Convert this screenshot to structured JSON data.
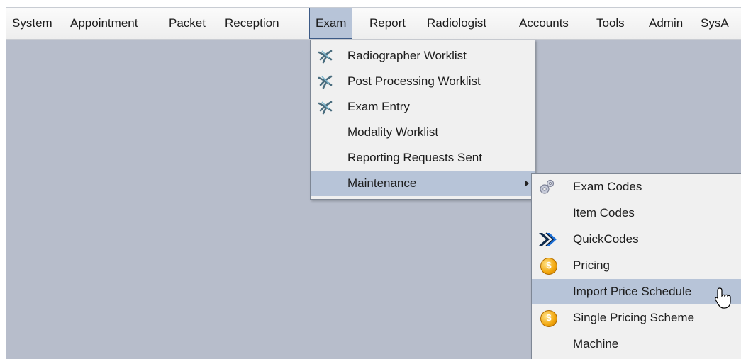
{
  "menubar": {
    "items": [
      {
        "label": "System",
        "underline": "y"
      },
      {
        "label": "Appointment"
      },
      {
        "label": "Packet"
      },
      {
        "label": "Reception"
      },
      {
        "label": "Exam",
        "active": true
      },
      {
        "label": "Report"
      },
      {
        "label": "Radiologist"
      },
      {
        "label": "Accounts"
      },
      {
        "label": "Tools"
      },
      {
        "label": "Admin"
      },
      {
        "label": "SysA"
      }
    ]
  },
  "exam_menu": {
    "items": [
      {
        "label": "Radiographer Worklist",
        "icon": "worklist-icon"
      },
      {
        "label": "Post Processing Worklist",
        "icon": "worklist-icon"
      },
      {
        "label": "Exam Entry",
        "icon": "worklist-icon"
      },
      {
        "label": "Modality Worklist"
      },
      {
        "label": "Reporting Requests Sent"
      },
      {
        "label": "Maintenance",
        "submenu": true,
        "selected": true
      }
    ]
  },
  "maintenance_menu": {
    "items": [
      {
        "label": "Exam Codes",
        "icon": "gears-icon"
      },
      {
        "label": "Item Codes"
      },
      {
        "label": "QuickCodes",
        "icon": "double-chevron-icon"
      },
      {
        "label": "Pricing",
        "icon": "coin-icon"
      },
      {
        "label": "Import Price Schedule",
        "selected": true
      },
      {
        "label": "Single Pricing Scheme",
        "icon": "coin-icon"
      },
      {
        "label": "Machine"
      }
    ]
  },
  "colors": {
    "desktop": "#b7bdcb",
    "menu_bg": "#f0f0f0",
    "selection": "#b7c4d8",
    "selection_border": "#3c5a86"
  }
}
